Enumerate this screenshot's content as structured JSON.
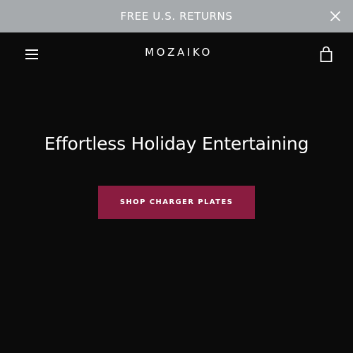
{
  "announcement": {
    "text": "FREE U.S. RETURNS",
    "close_icon": "close-icon"
  },
  "header": {
    "menu_icon": "hamburger-menu-icon",
    "logo": "MOZAIKO",
    "cart_icon": "shopping-bag-icon"
  },
  "hero": {
    "title": "Effortless Holiday Entertaining",
    "cta_label": "SHOP CHARGER PLATES"
  },
  "colors": {
    "announcement_bg": "#a6aaad",
    "page_bg": "#0b0b0b",
    "cta_bg": "#8a1c40",
    "text": "#ffffff"
  }
}
